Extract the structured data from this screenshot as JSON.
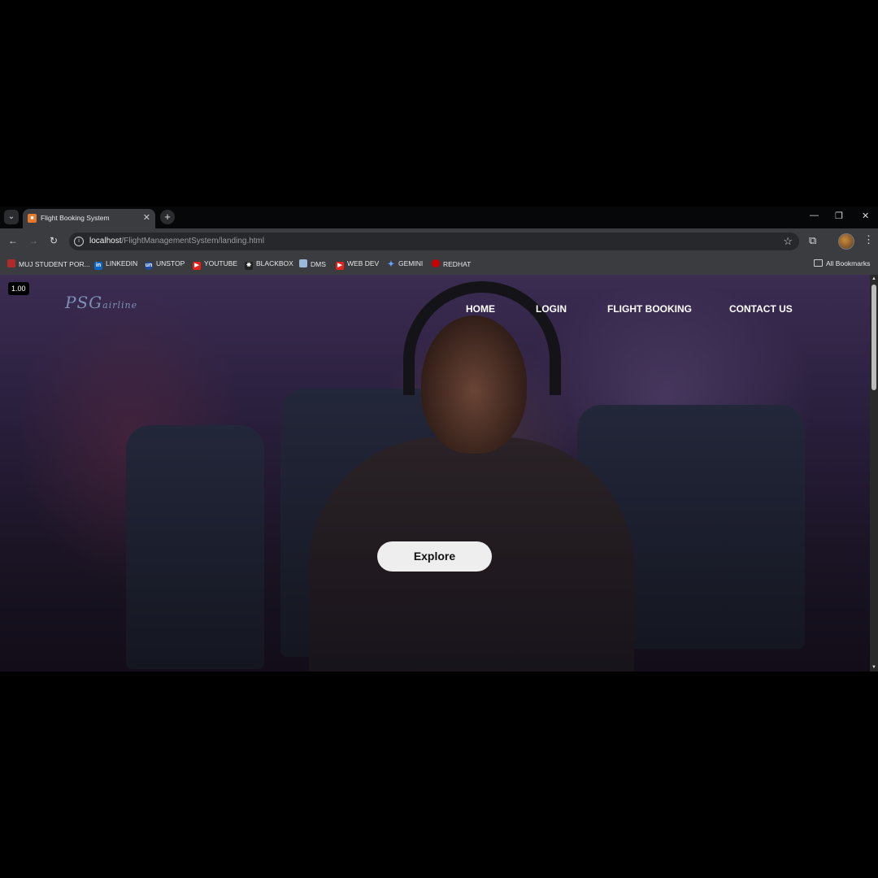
{
  "browser": {
    "tab_title": "Flight Booking System",
    "url_host": "localhost",
    "url_path": "/FlightManagementSystem/landing.html"
  },
  "bookmarks": {
    "items": [
      {
        "label": "MUJ STUDENT POR...",
        "icon": "muj-icon"
      },
      {
        "label": "LINKEDIN",
        "icon": "linkedin-icon"
      },
      {
        "label": "UNSTOP",
        "icon": "unstop-icon"
      },
      {
        "label": "YOUTUBE",
        "icon": "youtube-icon"
      },
      {
        "label": "BLACKBOX",
        "icon": "blackbox-icon"
      },
      {
        "label": "DMS",
        "icon": "document-icon"
      },
      {
        "label": "WEB DEV",
        "icon": "youtube-icon"
      },
      {
        "label": "GEMINI",
        "icon": "gemini-icon"
      },
      {
        "label": "REDHAT",
        "icon": "redhat-icon"
      }
    ],
    "all_bookmarks": "All Bookmarks"
  },
  "page": {
    "zoom_badge": "1.00",
    "logo_main": "PSG",
    "logo_sub": "airline",
    "nav": [
      "HOME",
      "LOGIN",
      "FLIGHT BOOKING",
      "CONTACT US"
    ],
    "cta": "Explore"
  },
  "colors": {
    "hero_overlay": "#2a1f3d",
    "cta_background": "#eeeeee",
    "nav_text": "#ffffff"
  }
}
